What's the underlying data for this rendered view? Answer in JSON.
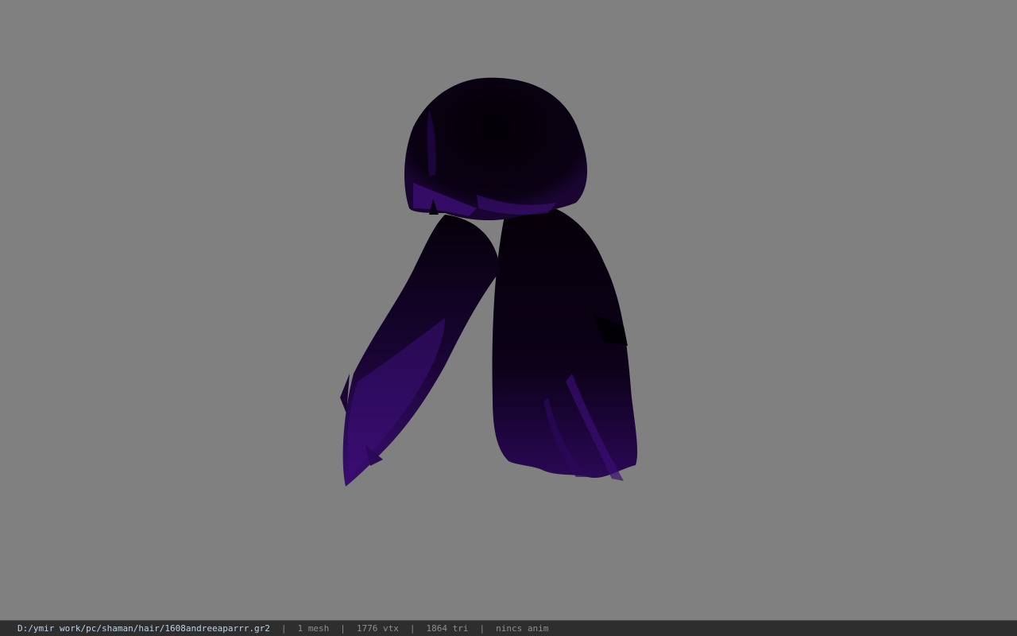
{
  "viewport": {
    "background": "#808080",
    "model_icon": "hair-mesh-icon",
    "hair_colors": {
      "base": "#0a0010",
      "highlight": "#3d0f78",
      "mid": "#1c0638"
    }
  },
  "status_bar": {
    "file_path": "D:/ymir work/pc/shaman/hair/1608andreeaparrr.gr2",
    "separator": "|",
    "mesh_count": "1 mesh",
    "vertex_count": "1776 vtx",
    "triangle_count": "1864 tri",
    "animation": "nincs anim"
  }
}
